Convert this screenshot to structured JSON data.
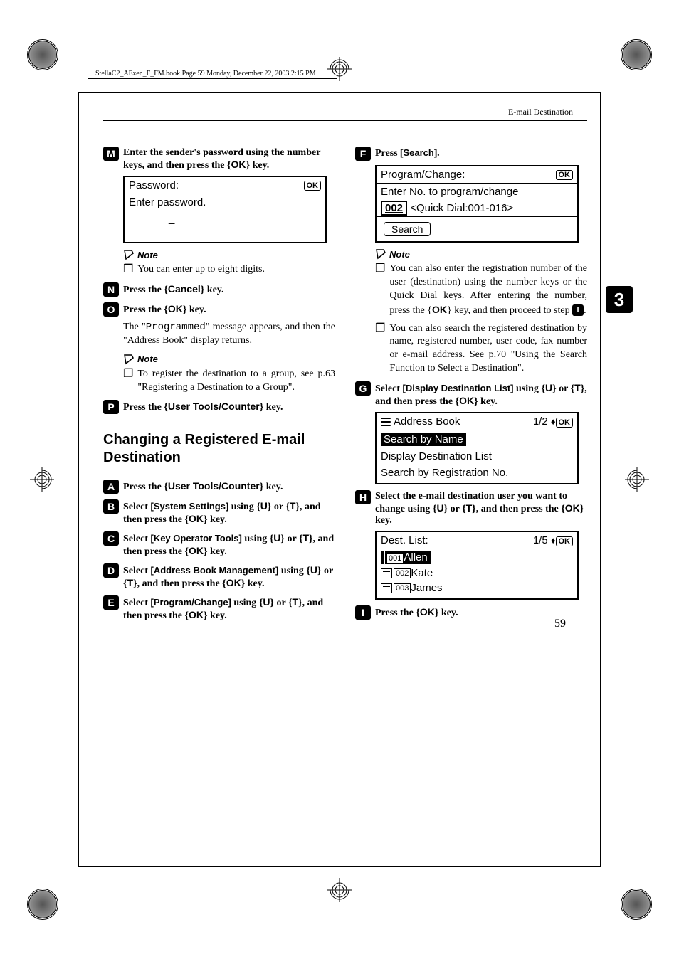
{
  "book_header": "StellaC2_AEzen_F_FM.book  Page 59  Monday, December 22, 2003  2:15 PM",
  "header_section": "E-mail Destination",
  "side_tab": "3",
  "page_number": "59",
  "left": {
    "s13": {
      "num": "M",
      "text_a": "Enter the sender's password using the number keys, and then press the ",
      "key": "OK",
      "text_b": " key."
    },
    "lcd1": {
      "r1_left": "Password:",
      "r1_ok": "OK",
      "r2": "Enter password.",
      "r3": "_"
    },
    "note1": {
      "head": "Note",
      "item": "You can enter up to eight digits."
    },
    "s14": {
      "num": "N",
      "text_a": "Press the ",
      "key": "Cancel",
      "text_b": " key."
    },
    "s15": {
      "num": "O",
      "text_a": "Press the ",
      "key": "OK",
      "text_b": " key."
    },
    "body1_a": "The \"",
    "body1_mono": "Programmed",
    "body1_b": "\" message appears, and then the \"Address Book\" display returns.",
    "note2": {
      "head": "Note",
      "item": "To register the destination to a group, see p.63 \"Registering a Destination to a Group\"."
    },
    "s16": {
      "num": "P",
      "text_a": "Press the ",
      "key": "User Tools/Counter",
      "text_b": " key."
    },
    "section_title": "Changing a Registered E-mail Destination",
    "s1": {
      "num": "A",
      "text_a": "Press the ",
      "key": "User Tools/Counter",
      "text_b": " key."
    },
    "s2": {
      "num": "B",
      "text_a": "Select ",
      "label": "[System Settings]",
      "text_b": " using ",
      "text_c": " or ",
      "text_d": ", and then press the ",
      "key": "OK",
      "text_e": " key."
    },
    "s3": {
      "num": "C",
      "text_a": "Select ",
      "label": "[Key Operator Tools]",
      "text_b": " using ",
      "text_c": " or ",
      "text_d": ", and then press the ",
      "key": "OK",
      "text_e": " key."
    },
    "s4": {
      "num": "D",
      "text_a": "Select ",
      "label": "[Address Book Management]",
      "text_b": " using ",
      "text_c": " or ",
      "text_d": ", and then press the ",
      "key": "OK",
      "text_e": " key."
    },
    "s5": {
      "num": "E",
      "text_a": " Select ",
      "label": "[Program/Change]",
      "text_b": " using ",
      "text_c": " or ",
      "text_d": ", and then press the ",
      "key": "OK",
      "text_e": " key."
    }
  },
  "right": {
    "s6": {
      "num": "F",
      "text_a": "Press ",
      "label": "[Search]",
      "text_b": "."
    },
    "lcd2": {
      "r1_left": "Program/Change:",
      "r1_ok": "OK",
      "r2": "Enter No. to program/change",
      "r3_num": "002",
      "r3_text": "<Quick Dial:001-016>",
      "r4_btn": "Search"
    },
    "note3": {
      "head": "Note",
      "item1_a": "You can also enter the registration number of the user (destination) using the number keys or the Quick Dial keys. After entering the number, press the ",
      "item1_key": "OK",
      "item1_b": " key, and then proceed to step ",
      "item1_ref": "I",
      "item1_c": ".",
      "item2": "You can also search the registered destination by name, registered number, user code, fax number or e-mail address. See p.70 \"Using the Search Function to Select a Destination\"."
    },
    "s7": {
      "num": "G",
      "text_a": "Select ",
      "label": "[Display Destination List]",
      "text_b": " using ",
      "text_c": " or ",
      "text_d": ", and then press the ",
      "key": "OK",
      "text_e": " key."
    },
    "lcd3": {
      "r1_left": "Address Book",
      "r1_right": "1/2",
      "r1_ok": "OK",
      "r2_sel": "Search by Name",
      "r3": "Display Destination List",
      "r4": "Search by Registration No."
    },
    "s8": {
      "num": "H",
      "text_a": "Select the e-mail destination user you want to change using ",
      "text_b": " or ",
      "text_c": ", and then press the ",
      "key": "OK",
      "text_d": " key."
    },
    "lcd4": {
      "r1_left": "Dest. List:",
      "r1_right": "1/5",
      "r1_ok": "OK",
      "n1": "001",
      "name1": "Allen",
      "n2": "002",
      "name2": "Kate",
      "n3": "003",
      "name3": "James"
    },
    "s9": {
      "num": "I",
      "text_a": "Press the ",
      "key": "OK",
      "text_b": " key."
    }
  }
}
